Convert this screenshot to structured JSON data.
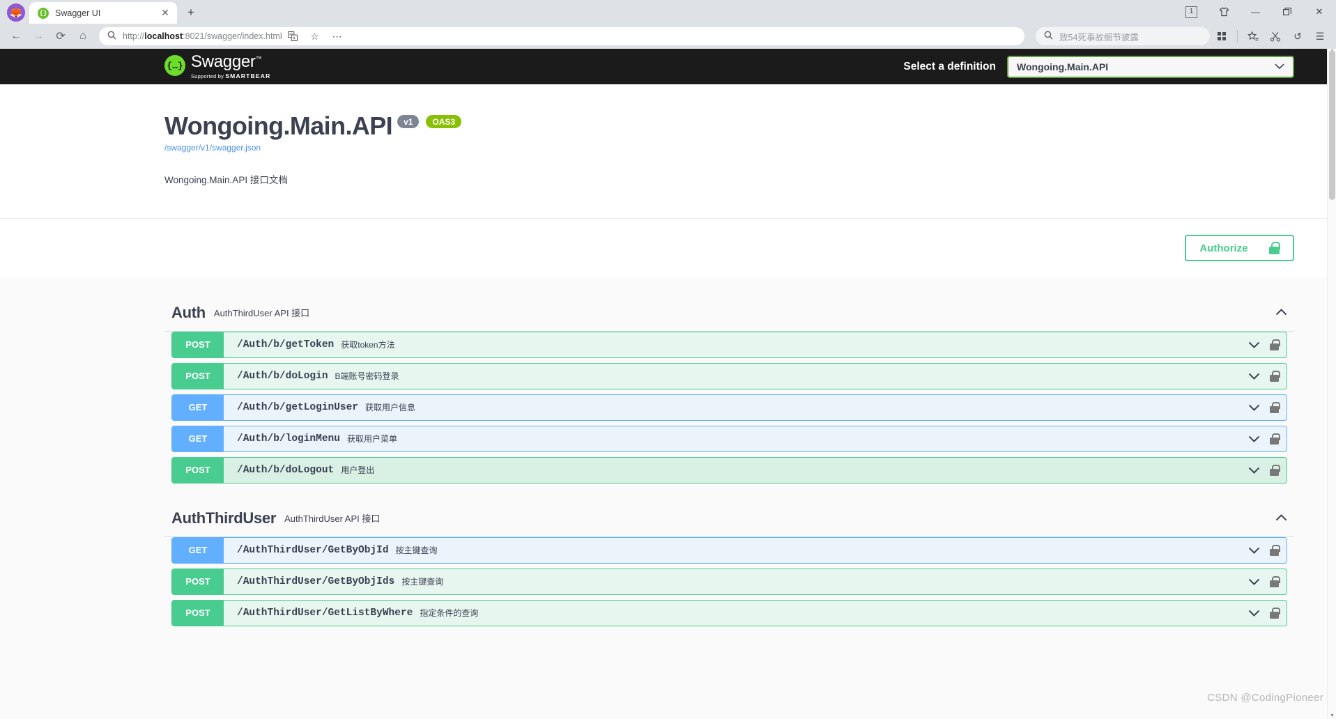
{
  "browser": {
    "tab": {
      "title": "Swagger UI",
      "favicon_icon": "swagger-favicon",
      "close_icon": "✕"
    },
    "new_tab_icon": "+",
    "window": {
      "tab_count_badge": "1",
      "theme_icon": "shirt-icon",
      "minimize_icon": "—",
      "maximize_icon": "❐",
      "close_icon": "✕"
    },
    "nav": {
      "back_icon": "←",
      "forward_icon": "→",
      "reload_icon": "⟳",
      "home_icon": "⌂"
    },
    "omnibox": {
      "search_icon": "search-icon",
      "url_scheme": "http://",
      "url_host": "localhost",
      "url_rest": ":8021/swagger/index.html"
    },
    "omnibox_actions": {
      "translate_icon": "translate-icon",
      "bookmark_icon": "☆",
      "more_icon": "⋯"
    },
    "search": {
      "icon": "search-icon",
      "query": "致54死事故细节披露"
    },
    "toolbar_icons": {
      "apps_icon": "grid-apps-icon",
      "collections_icon": "favorites-icon",
      "clip_icon": "scissors-icon",
      "history_icon": "↺",
      "menu_icon": "☰"
    }
  },
  "swagger": {
    "logo": {
      "mark": "{…}",
      "word": "Swagger",
      "trademark": "™",
      "supported_by": "Supported by",
      "brand": "SMARTBEAR"
    },
    "definition_selector": {
      "label": "Select a definition",
      "selected": "Wongoing.Main.API",
      "chevron_icon": "chevron-down-icon"
    },
    "info": {
      "title": "Wongoing.Main.API",
      "version_badge": "v1",
      "spec_badge": "OAS3",
      "spec_url": "/swagger/v1/swagger.json",
      "description": "Wongoing.Main.API 接口文档"
    },
    "authorize": {
      "label": "Authorize",
      "lock_icon": "lock-open-icon"
    },
    "sections": [
      {
        "title": "Auth",
        "subtitle": "AuthThirdUser API 接口",
        "collapse_icon": "chevron-up-icon",
        "operations": [
          {
            "verb": "POST",
            "path": "/Auth/b/getToken",
            "summary": "获取token方法",
            "state": "normal"
          },
          {
            "verb": "POST",
            "path": "/Auth/b/doLogin",
            "summary": "B端账号密码登录",
            "state": "normal"
          },
          {
            "verb": "GET",
            "path": "/Auth/b/getLoginUser",
            "summary": "获取用户信息",
            "state": "normal"
          },
          {
            "verb": "GET",
            "path": "/Auth/b/loginMenu",
            "summary": "获取用户菜单",
            "state": "normal"
          },
          {
            "verb": "POST",
            "path": "/Auth/b/doLogout",
            "summary": "用户登出",
            "state": "hover"
          }
        ]
      },
      {
        "title": "AuthThirdUser",
        "subtitle": "AuthThirdUser API 接口",
        "collapse_icon": "chevron-up-icon",
        "operations": [
          {
            "verb": "GET",
            "path": "/AuthThirdUser/GetByObjId",
            "summary": "按主键查询",
            "state": "normal"
          },
          {
            "verb": "POST",
            "path": "/AuthThirdUser/GetByObjIds",
            "summary": "按主键查询",
            "state": "normal"
          },
          {
            "verb": "POST",
            "path": "/AuthThirdUser/GetListByWhere",
            "summary": "指定条件的查询",
            "state": "normal"
          }
        ]
      }
    ],
    "op_row_icons": {
      "expand_icon": "chevron-down-icon",
      "auth_icon": "lock-open-icon"
    }
  },
  "watermark": "CSDN @CodingPioneer"
}
